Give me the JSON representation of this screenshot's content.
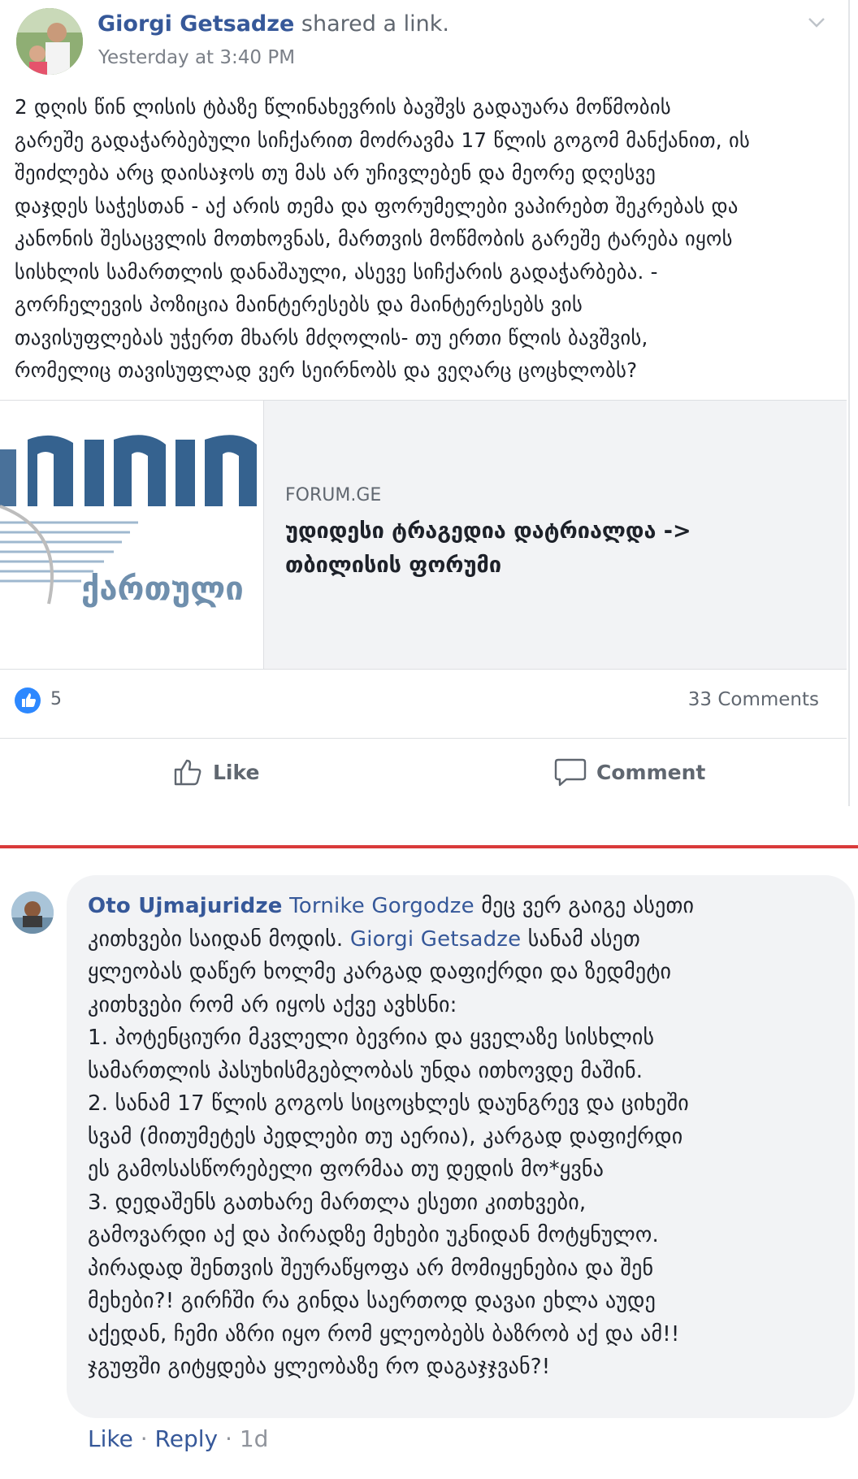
{
  "post": {
    "author_name": "Giorgi Getsadze",
    "action_text": "shared a link.",
    "timestamp": "Yesterday at 3:40 PM",
    "menu_icon": "chevron-down-icon",
    "text": "2 დღის წინ ლისის ტბაზე წლინახევრის ბავშვს გადაუარა მოწმობის\nგარეშე გადაჭარბებული სიჩქარით მოძრავმა 17 წლის გოგომ მანქანით, ის\nშეიძლება არც დაისაჯოს თუ მას არ უჩივლებენ და მეორე დღესვე\nდაჯდეს საჭესთან - აქ არის თემა და ფორუმელები ვაპირებთ შეკრებას და\nკანონის შესაცვლის მოთხოვნას, მართვის მოწმობის გარეშე ტარება იყოს\nსისხლის სამართლის დანაშაული, ასევე სიჩქარის გადაჭარბება. -\nგორჩელევის პოზიცია მაინტერესებს და მაინტერესებს ვის\nთავისუფლებას უჭერთ მხარს მძღოლის- თუ ერთი წლის ბავშვის,\nრომელიც თავისუფლად ვერ სეირნობს და ვეღარც ცოცხლობს?",
    "link": {
      "domain": "FORUM.GE",
      "title": "უდიდესი ტრაგედია დატრიალდა -> თბილისის ფორუმი",
      "thumb_text": "ქართული"
    },
    "like_count": "5",
    "comments_count": "33 Comments",
    "like_label": "Like",
    "comment_label": "Comment"
  },
  "comment": {
    "author_name": "Oto Ujmajuridze",
    "mention_1": "Tornike Gorgodze",
    "mention_2": "Giorgi Getsadze",
    "lines": [
      {
        "pre": "",
        "text": " მეც ვერ გაიგე ასეთი"
      },
      {
        "text": "კითხვები საიდან მოდის. "
      },
      {
        "text": "ყლეობას დაწერ ხოლმე კარგად დაფიქრდი და ზედმეტი"
      },
      {
        "text": "კითხვები რომ არ იყოს აქვე ავხსნი:"
      },
      {
        "text": "1. პოტენციური მკვლელი ბევრია და ყველაზე სისხლის"
      },
      {
        "text": "სამართლის პასუხისმგებლობას უნდა ითხოვდე მაშინ."
      },
      {
        "text": "2. სანამ 17 წლის გოგოს სიცოცხლეს დაუნგრევ და ციხეში"
      },
      {
        "text": "სვამ (მითუმეტეს პედლები თუ აერია), კარგად დაფიქრდი"
      },
      {
        "text": "ეს გამოსასწორებელი ფორმაა თუ დედის მო*ყვნა"
      },
      {
        "text": "3. დედაშენს გათხარე მართლა ესეთი კითხვები,"
      },
      {
        "text": "გამოვარდი აქ და პირადზე მეხები უკნიდან მოტყნულო."
      },
      {
        "text": "პირადად შენთვის შეურაწყოფა არ მომიყენებია და შენ"
      },
      {
        "text": "მეხები?! გირჩში რა გინდა საერთოდ დავაი ეხლა აუდე"
      },
      {
        "text": "აქედან, ჩემი აზრი იყო რომ ყლეობებს ბაზრობ აქ და ამ!!"
      },
      {
        "text": "ჯგუფში გიტყდება ყლეობაზე რო დაგაჯჯვან?!"
      }
    ],
    "line2_suffix": " სანამ ასეთ",
    "like_label": "Like",
    "separator": "·",
    "reply_label": "Reply",
    "age": "1d"
  },
  "colors": {
    "link_blue": "#365899",
    "divider_red": "#d93a3a",
    "like_blue": "#2d88ff"
  }
}
